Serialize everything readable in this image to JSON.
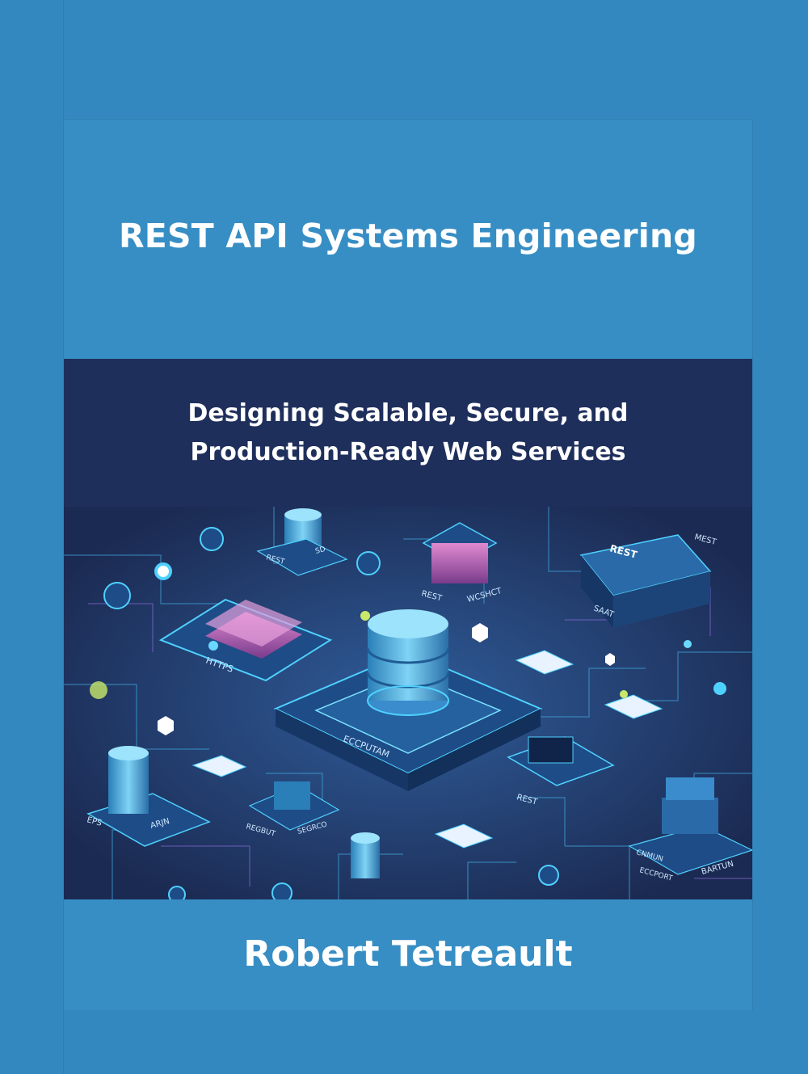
{
  "book": {
    "title": "REST API Systems Engineering",
    "subtitle": "Designing Scalable, Secure, and Production-Ready Web Services",
    "author": "Robert Tetreault"
  },
  "illustration": {
    "labels": [
      "REST",
      "SD",
      "REST",
      "WCSHCT",
      "REST",
      "MEST",
      "SAAT",
      "HTTPS",
      "ECCPUTAM",
      "REST",
      "EPS",
      "ARJN",
      "REGBUT",
      "SEGRCO",
      "CNMUN",
      "ECCPORT",
      "BARTUN"
    ]
  },
  "colors": {
    "background": "#3389bf",
    "panel": "#378ec4",
    "subtitle_band": "#1f2f5c",
    "art_background": "#1b2a52",
    "accent_cyan": "#4fd1ff",
    "accent_magenta": "#c46ab5"
  }
}
